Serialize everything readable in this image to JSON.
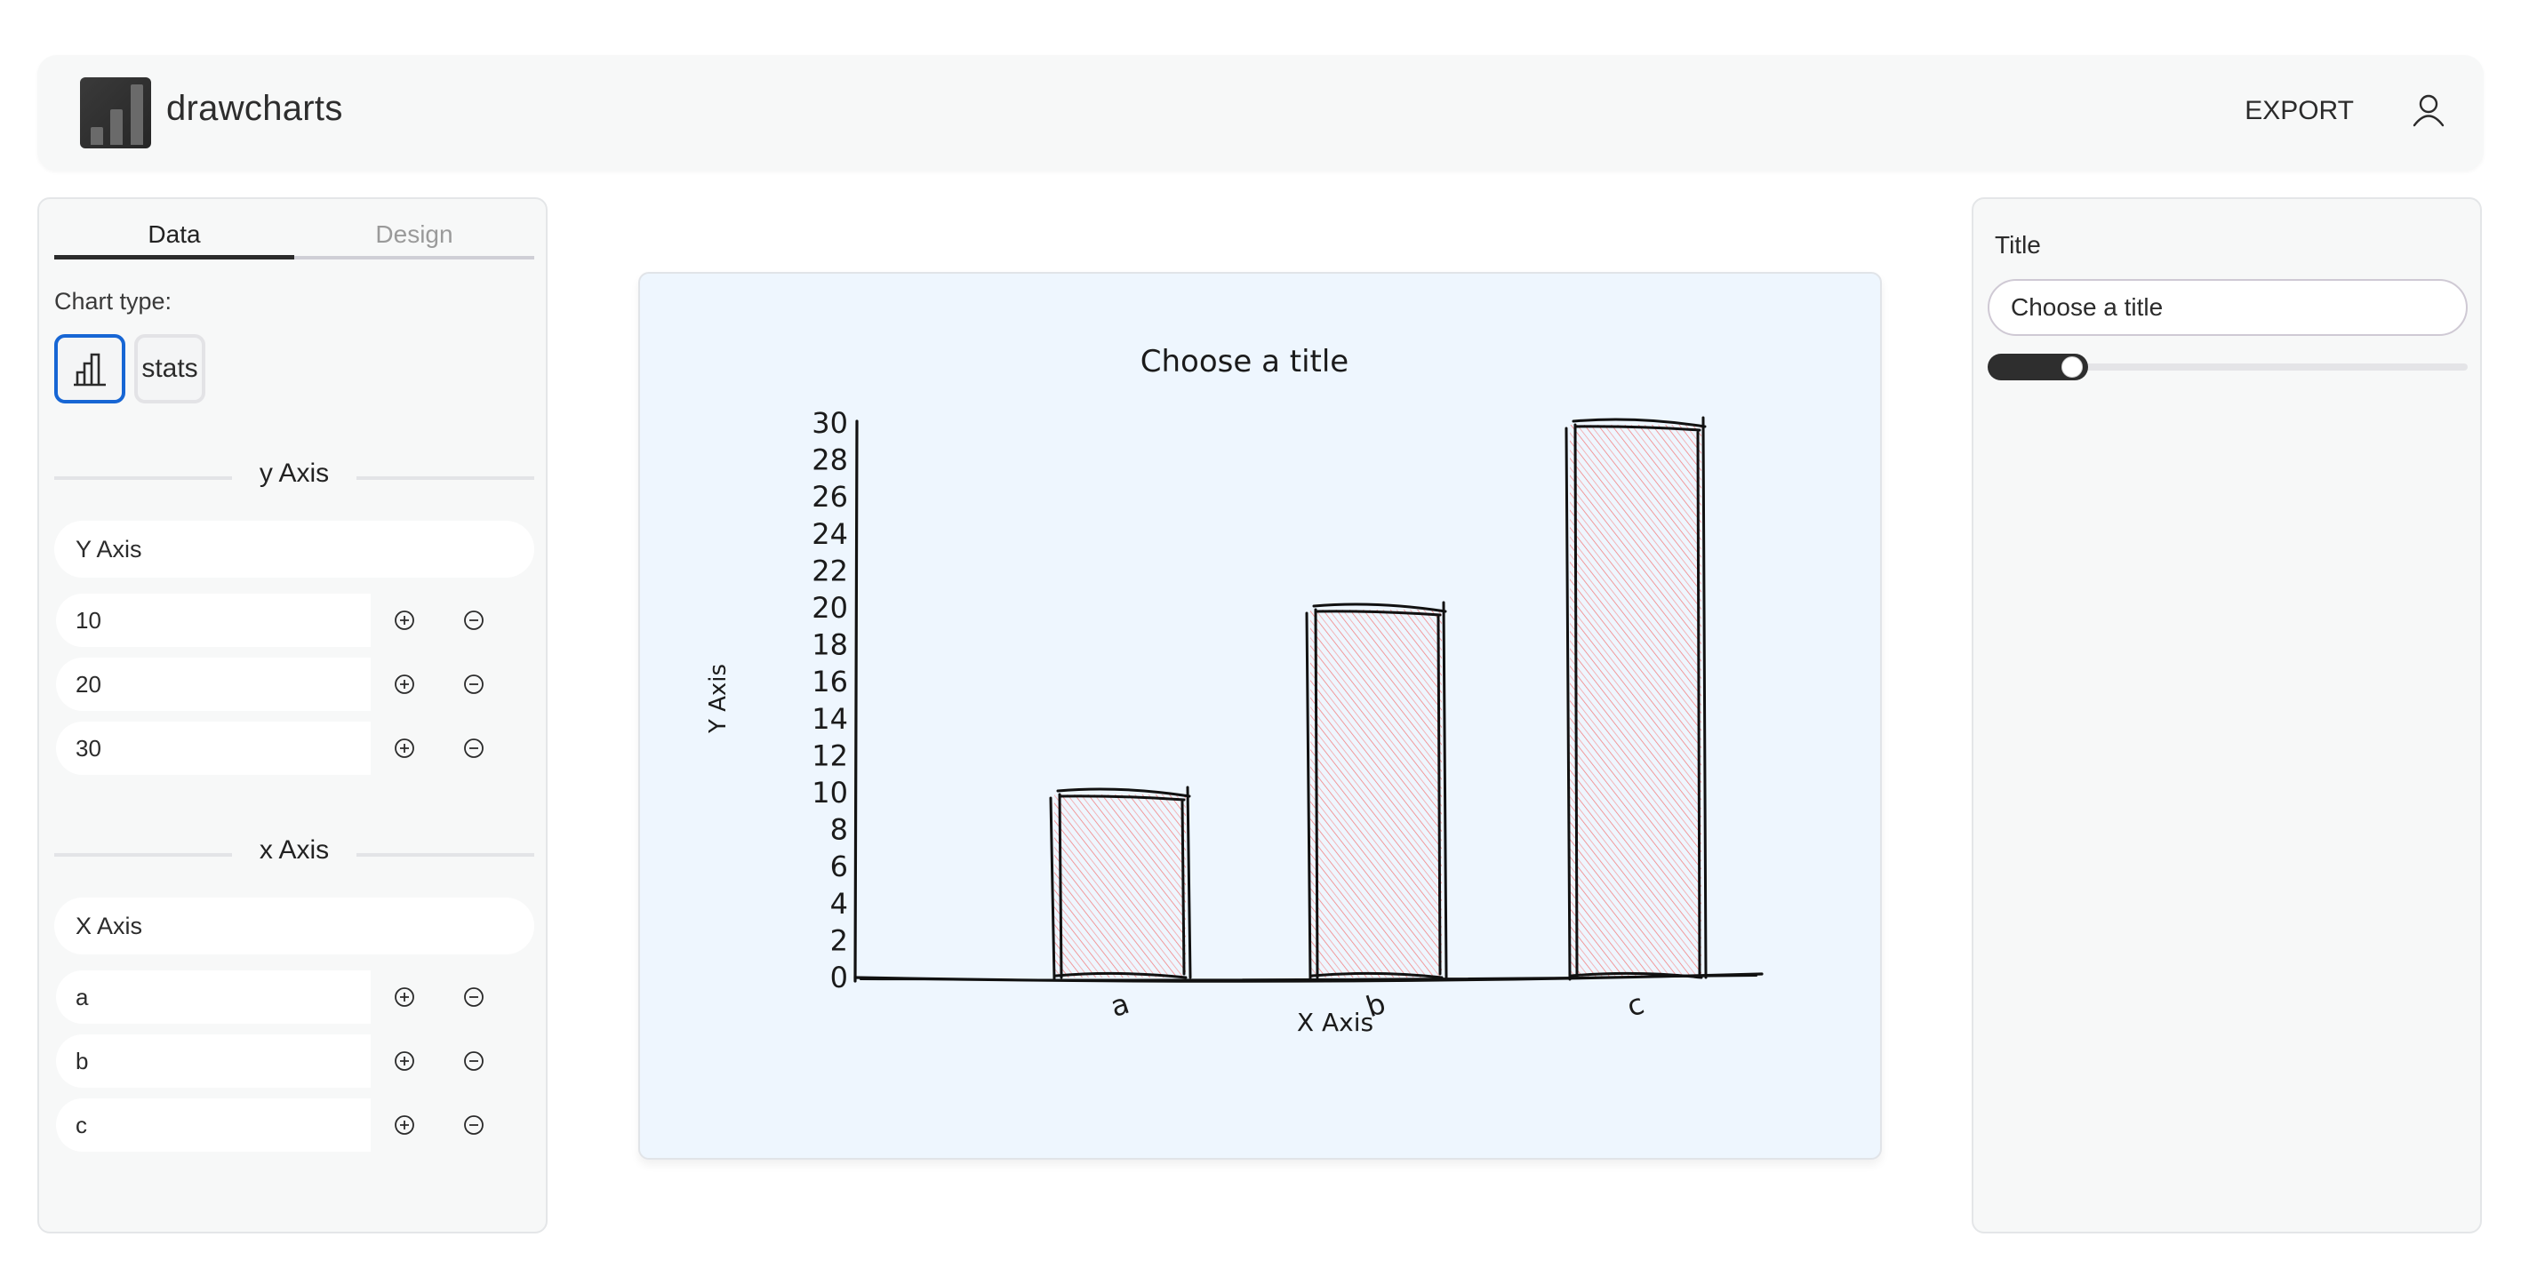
{
  "header": {
    "brand": "drawcharts",
    "logo_icon": "bar-chart-logo-icon",
    "export_label": "EXPORT",
    "user_icon": "user-icon"
  },
  "left_panel": {
    "tabs": [
      {
        "label": "Data",
        "active": true
      },
      {
        "label": "Design",
        "active": false
      }
    ],
    "chart_type_label": "Chart type:",
    "chart_types": [
      {
        "icon": "bar-chart-icon",
        "selected": true
      },
      {
        "label": "stats",
        "selected": false
      }
    ],
    "y_axis": {
      "section_title": "y Axis",
      "name_value": "Y Axis",
      "values": [
        "10",
        "20",
        "30"
      ]
    },
    "x_axis": {
      "section_title": "x Axis",
      "name_value": "X Axis",
      "values": [
        "a",
        "b",
        "c"
      ]
    },
    "row_actions": {
      "add_icon": "plus-circle-icon",
      "remove_icon": "minus-circle-icon"
    }
  },
  "right_panel": {
    "title_label": "Title",
    "title_value": "Choose a title",
    "slider_value": 0.16
  },
  "colors": {
    "accent": "#1766d4",
    "bar_fill": "#f06b6b",
    "chart_bg": "#eef6fe",
    "ink": "#1b1b1b"
  },
  "chart_data": {
    "type": "bar",
    "title": "Choose a title",
    "xlabel": "X Axis",
    "ylabel": "Y Axis",
    "categories": [
      "a",
      "b",
      "c"
    ],
    "values": [
      10,
      20,
      30
    ],
    "ylim": [
      0,
      30
    ],
    "yticks": [
      0,
      2,
      4,
      6,
      8,
      10,
      12,
      14,
      16,
      18,
      20,
      22,
      24,
      26,
      28,
      30
    ],
    "grid": false,
    "legend": "none",
    "style": "hand-drawn"
  }
}
